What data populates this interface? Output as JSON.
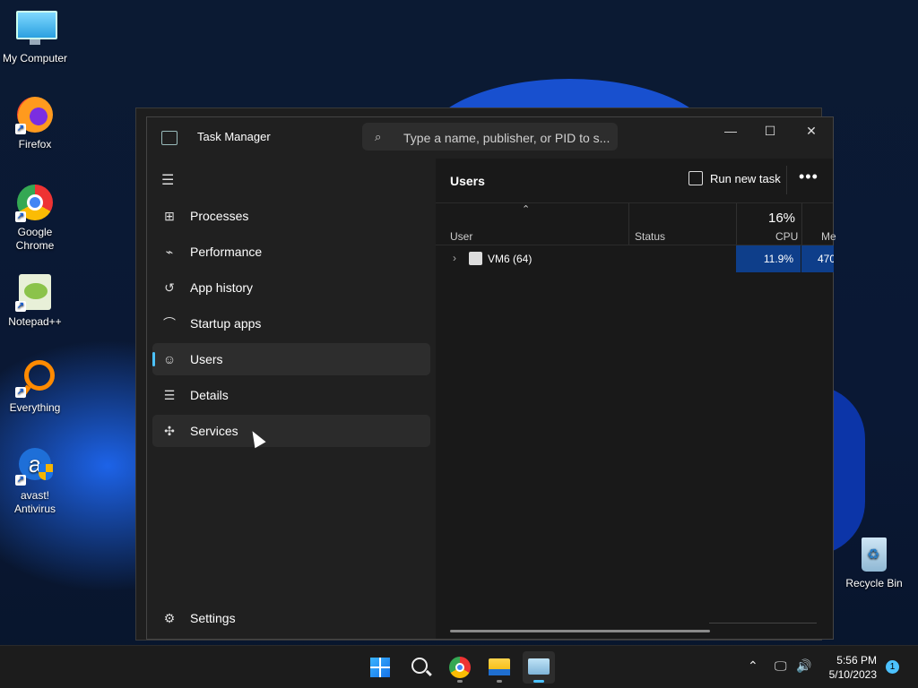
{
  "desktop": {
    "icons": [
      {
        "label": "My Computer",
        "icon": "monitor-icon"
      },
      {
        "label": "Firefox",
        "icon": "firefox-icon"
      },
      {
        "label": "Google Chrome",
        "icon": "chrome-icon"
      },
      {
        "label": "Notepad++",
        "icon": "notepadpp-icon"
      },
      {
        "label": "Everything",
        "icon": "search-magnifier-icon"
      },
      {
        "label": "avast! Antivirus",
        "icon": "avast-icon"
      },
      {
        "label": "Recycle Bin",
        "icon": "recycle-bin-icon"
      }
    ]
  },
  "window": {
    "title": "Task Manager",
    "search_placeholder": "Type a name, publisher, or PID to s...",
    "controls": {
      "minimize": "—",
      "maximize": "☐",
      "close": "✕"
    }
  },
  "sidebar": {
    "items": [
      {
        "label": "Processes",
        "icon": "processes-icon",
        "glyph": "⊞"
      },
      {
        "label": "Performance",
        "icon": "performance-icon",
        "glyph": "⌁"
      },
      {
        "label": "App history",
        "icon": "history-icon",
        "glyph": "↺"
      },
      {
        "label": "Startup apps",
        "icon": "gauge-icon",
        "glyph": "⌒"
      },
      {
        "label": "Users",
        "icon": "users-icon",
        "glyph": "☺"
      },
      {
        "label": "Details",
        "icon": "details-list-icon",
        "glyph": "☰"
      },
      {
        "label": "Services",
        "icon": "puzzle-icon",
        "glyph": "✣"
      }
    ],
    "active": "Users",
    "settings_label": "Settings"
  },
  "main": {
    "title": "Users",
    "run_new_task": "Run new task",
    "more": "•••",
    "columns": {
      "user": "User",
      "status": "Status",
      "cpu_label": "CPU",
      "cpu_total": "16%",
      "mem_label": "Me"
    },
    "rows": [
      {
        "user": "VM6 (64)",
        "status": "",
        "cpu": "11.9%",
        "mem": "470"
      }
    ]
  },
  "taskbar": {
    "apps": [
      "start-icon",
      "search-icon",
      "chrome-icon",
      "file-explorer-icon",
      "task-manager-icon"
    ],
    "time": "5:56 PM",
    "date": "5/10/2023",
    "notification_count": "1"
  },
  "colors": {
    "accent": "#4cc2ff",
    "selection": "#0e3e8a",
    "window_bg": "#202020"
  }
}
